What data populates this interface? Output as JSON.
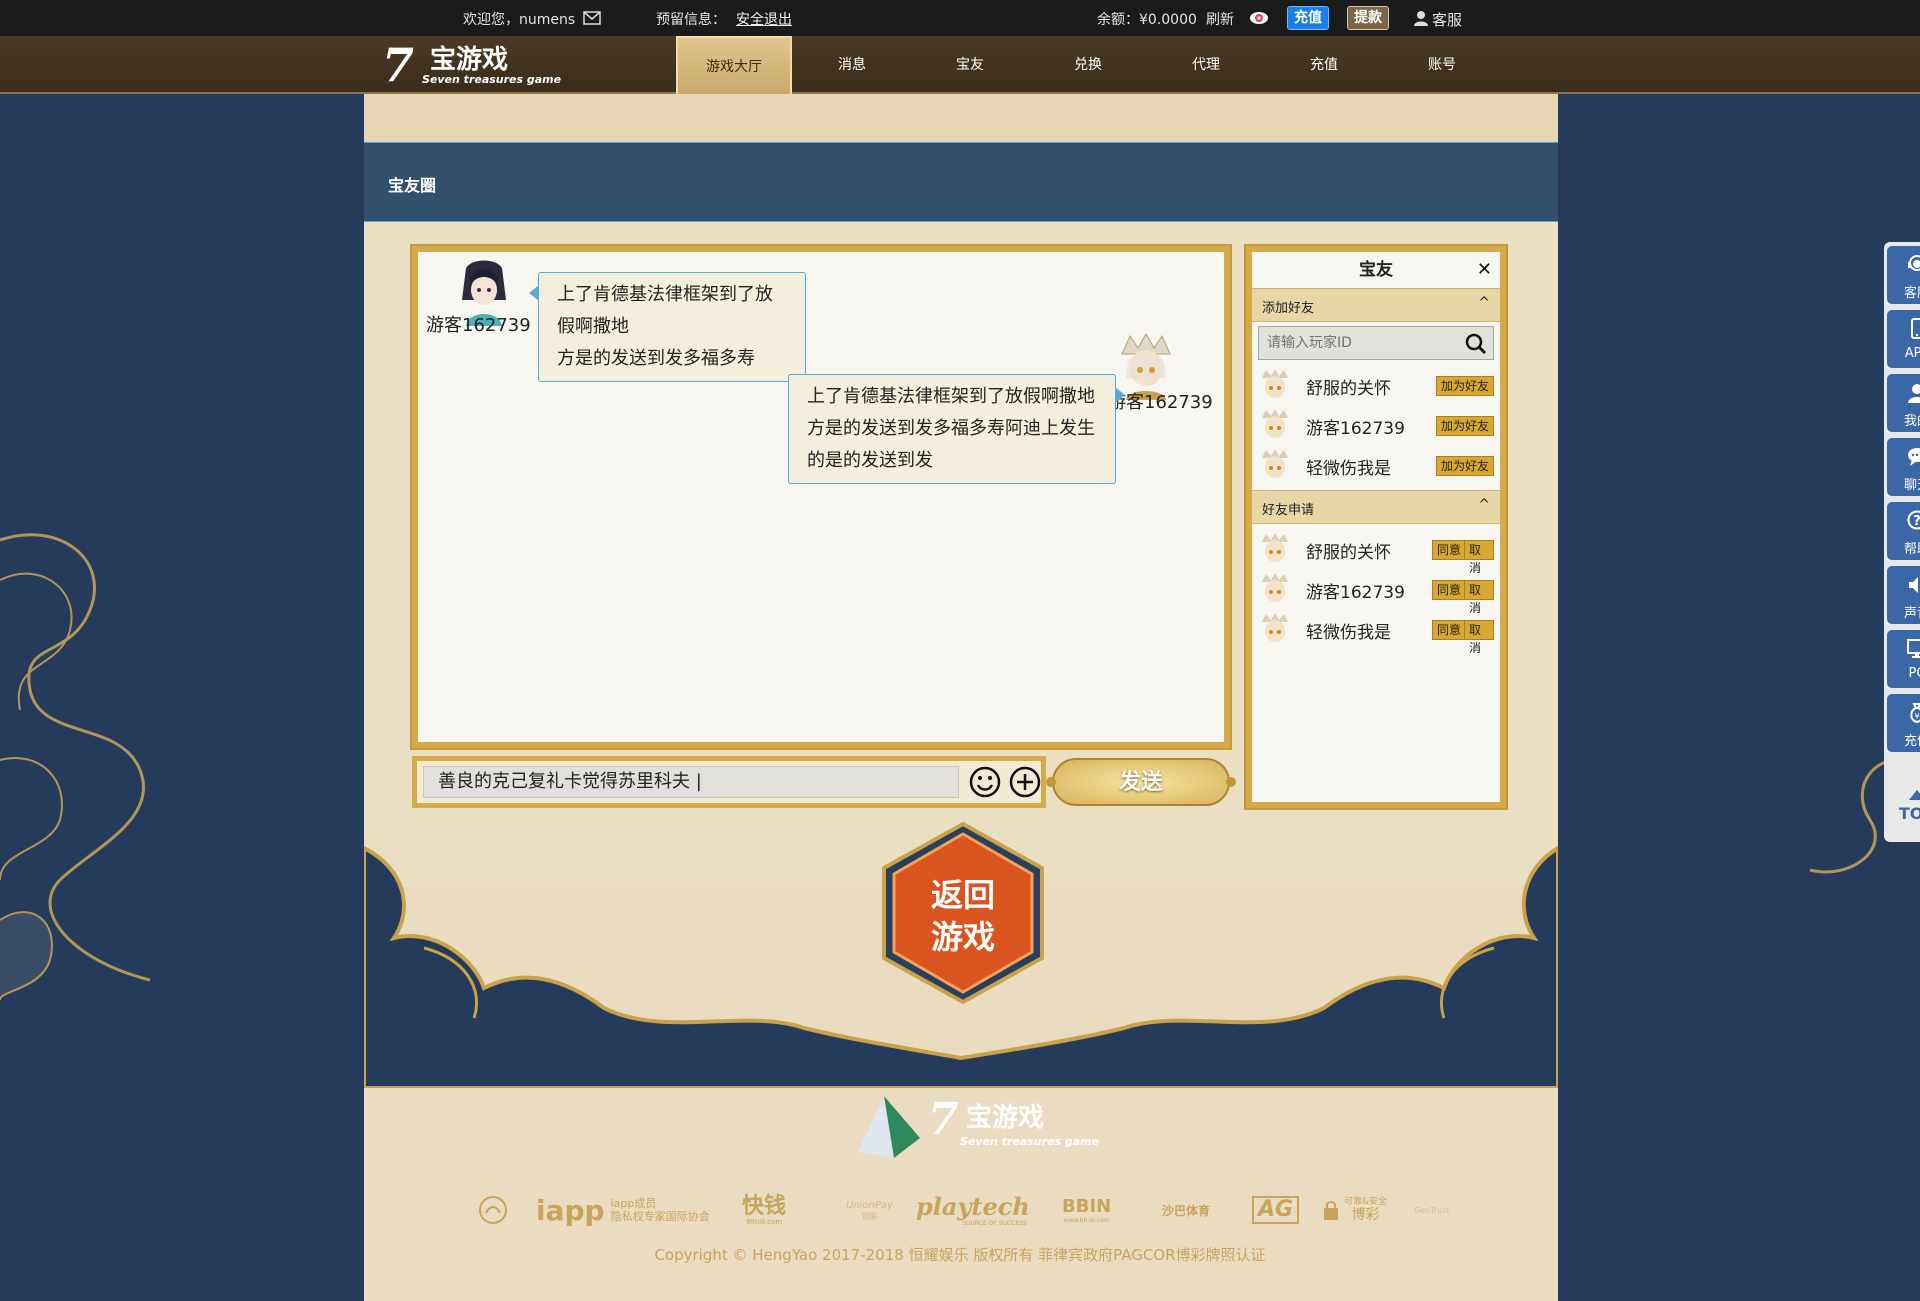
{
  "topbar": {
    "welcome": "欢迎您，numens",
    "notice_label": "预留信息：",
    "logout": "安全退出",
    "balance": "余额：¥0.0000",
    "refresh": "刷新",
    "recharge_btn": "充值",
    "withdraw_btn": "提款",
    "service": "客服"
  },
  "logo": {
    "number": "7",
    "cn": "宝游戏",
    "en": "Seven treasures game"
  },
  "nav": {
    "items": [
      "游戏大厅",
      "消息",
      "宝友",
      "兑换",
      "代理",
      "充值",
      "账号"
    ],
    "active_index": 0
  },
  "page": {
    "section_title": "宝友圈"
  },
  "chat": {
    "messages": [
      {
        "side": "left",
        "name": "游客162739",
        "lines": [
          "上了肯德基法律框架到了放假啊撒地",
          "方是的发送到发多福多寿"
        ]
      },
      {
        "side": "right",
        "name": "游客162739",
        "lines": [
          "上了肯德基法律框架到了放假啊撒地",
          "方是的发送到发多福多寿阿迪上发生",
          "的是的发送到发"
        ]
      }
    ],
    "input_value": "善良的克己复礼卡觉得苏里科夫 |",
    "send_label": "发送"
  },
  "friends": {
    "title": "宝友",
    "close_icon": "close-icon",
    "add_section": "添加好友",
    "search_placeholder": "请输入玩家ID",
    "add_list": [
      {
        "name": "舒服的关怀",
        "action": "加为好友"
      },
      {
        "name": "游客162739",
        "action": "加为好友"
      },
      {
        "name": "轻微伤我是",
        "action": "加为好友"
      }
    ],
    "request_section": "好友申请",
    "request_list": [
      {
        "name": "舒服的关怀",
        "accept": "同意",
        "cancel": "取消"
      },
      {
        "name": "游客162739",
        "accept": "同意",
        "cancel": "取消"
      },
      {
        "name": "轻微伤我是",
        "accept": "同意",
        "cancel": "取消"
      }
    ]
  },
  "return_game": {
    "line1": "返回",
    "line2": "游戏"
  },
  "footer": {
    "partners": [
      {
        "name": "PAGCOR"
      },
      {
        "name": "iapp",
        "sub1": "iapp成员",
        "sub2": "隐私权专家国际协会"
      },
      {
        "name": "快钱",
        "sub1": "99bill.com"
      },
      {
        "name": "UnionPay",
        "sub1": "银联"
      },
      {
        "name": "playtech",
        "sub1": "SOURCE OF SUCCESS"
      },
      {
        "name": "BBIN",
        "sub1": "www.bb-in.com"
      },
      {
        "name": "沙巴体育"
      },
      {
        "name": "AG"
      },
      {
        "name": "博彩",
        "sub1": "可靠&安全"
      },
      {
        "name": "GeoTrust"
      }
    ],
    "copyright": "Copyright © HengYao 2017-2018 恒耀娱乐 版权所有 菲律宾政府PAGCOR博彩牌照认证"
  },
  "sidebar": {
    "items": [
      "客服",
      "APP",
      "我的",
      "聊天",
      "帮助",
      "声音",
      "PC",
      "充值"
    ],
    "top": "TOP"
  },
  "colors": {
    "navy_bg": "#253b5c",
    "gold": "#d4aa4a",
    "parchment": "#ebdfc3",
    "strip_blue": "#34506f",
    "button_blue": "#1a7fe6",
    "side_blue": "#3c67a6",
    "hex_orange": "#d9541e"
  }
}
